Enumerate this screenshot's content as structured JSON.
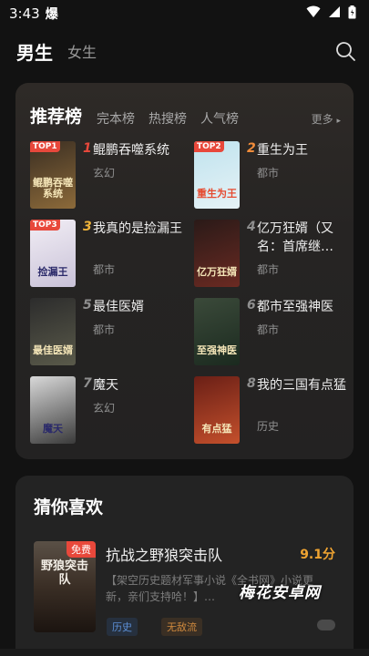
{
  "status_bar": {
    "time": "3:43",
    "notification_icon": "爆"
  },
  "gender_tabs": [
    {
      "label": "男生",
      "active": true
    },
    {
      "label": "女生",
      "active": false
    }
  ],
  "rank_section": {
    "tabs": [
      "推荐榜",
      "完本榜",
      "热搜榜",
      "人气榜"
    ],
    "more_label": "更多",
    "books": [
      {
        "rank": "1",
        "title": "鲲鹏吞噬系统",
        "genre": "玄幻",
        "badge": "TOP1",
        "cover_text": "鲲鹏吞噬系统",
        "rank_color": "#e8483b",
        "cover_colors": [
          "#3a2e22",
          "#8c6a3a"
        ]
      },
      {
        "rank": "2",
        "title": "重生为王",
        "genre": "都市",
        "badge": "TOP2",
        "cover_text": "重生为王",
        "rank_color": "#f08c3a",
        "cover_colors": [
          "#bfe3ee",
          "#e6f2f6"
        ]
      },
      {
        "rank": "3",
        "title": "我真的是捡漏王",
        "genre": "都市",
        "badge": "TOP3",
        "cover_text": "捡漏王",
        "rank_color": "#f0b43a",
        "cover_colors": [
          "#f2eef5",
          "#c9c2d8"
        ]
      },
      {
        "rank": "4",
        "title": "亿万狂婿（又名：首席继…",
        "genre": "都市",
        "badge": "",
        "cover_text": "亿万狂婿",
        "rank_color": "#8f8f8f",
        "cover_colors": [
          "#2a1a18",
          "#6b2a22"
        ]
      },
      {
        "rank": "5",
        "title": "最佳医婿",
        "genre": "都市",
        "badge": "",
        "cover_text": "最佳医婿",
        "rank_color": "#8f8f8f",
        "cover_colors": [
          "#2c2c2c",
          "#5a5a4a"
        ]
      },
      {
        "rank": "6",
        "title": "都市至强神医",
        "genre": "都市",
        "badge": "",
        "cover_text": "至强神医",
        "rank_color": "#8f8f8f",
        "cover_colors": [
          "#3b4a3a",
          "#1b2a1f"
        ]
      },
      {
        "rank": "7",
        "title": "魔天",
        "genre": "玄幻",
        "badge": "",
        "cover_text": "魔天",
        "rank_color": "#8f8f8f",
        "cover_colors": [
          "#d9d9d9",
          "#3a3a3a"
        ]
      },
      {
        "rank": "8",
        "title": "我的三国有点猛",
        "genre": "历史",
        "badge": "",
        "cover_text": "有点猛",
        "rank_color": "#8f8f8f",
        "cover_colors": [
          "#6a1f16",
          "#c4502c"
        ]
      }
    ]
  },
  "guess_section": {
    "title": "猜你喜欢",
    "book": {
      "title": "抗战之野狼突击队",
      "score": "9.1分",
      "badge": "免费",
      "cover_text": "野狼突击队",
      "description": "【架空历史题材军事小说《全书网》小说更新，亲们支持哈！】…",
      "tags": [
        "历史",
        "无敌流"
      ]
    }
  },
  "watermark": "梅花安卓网"
}
